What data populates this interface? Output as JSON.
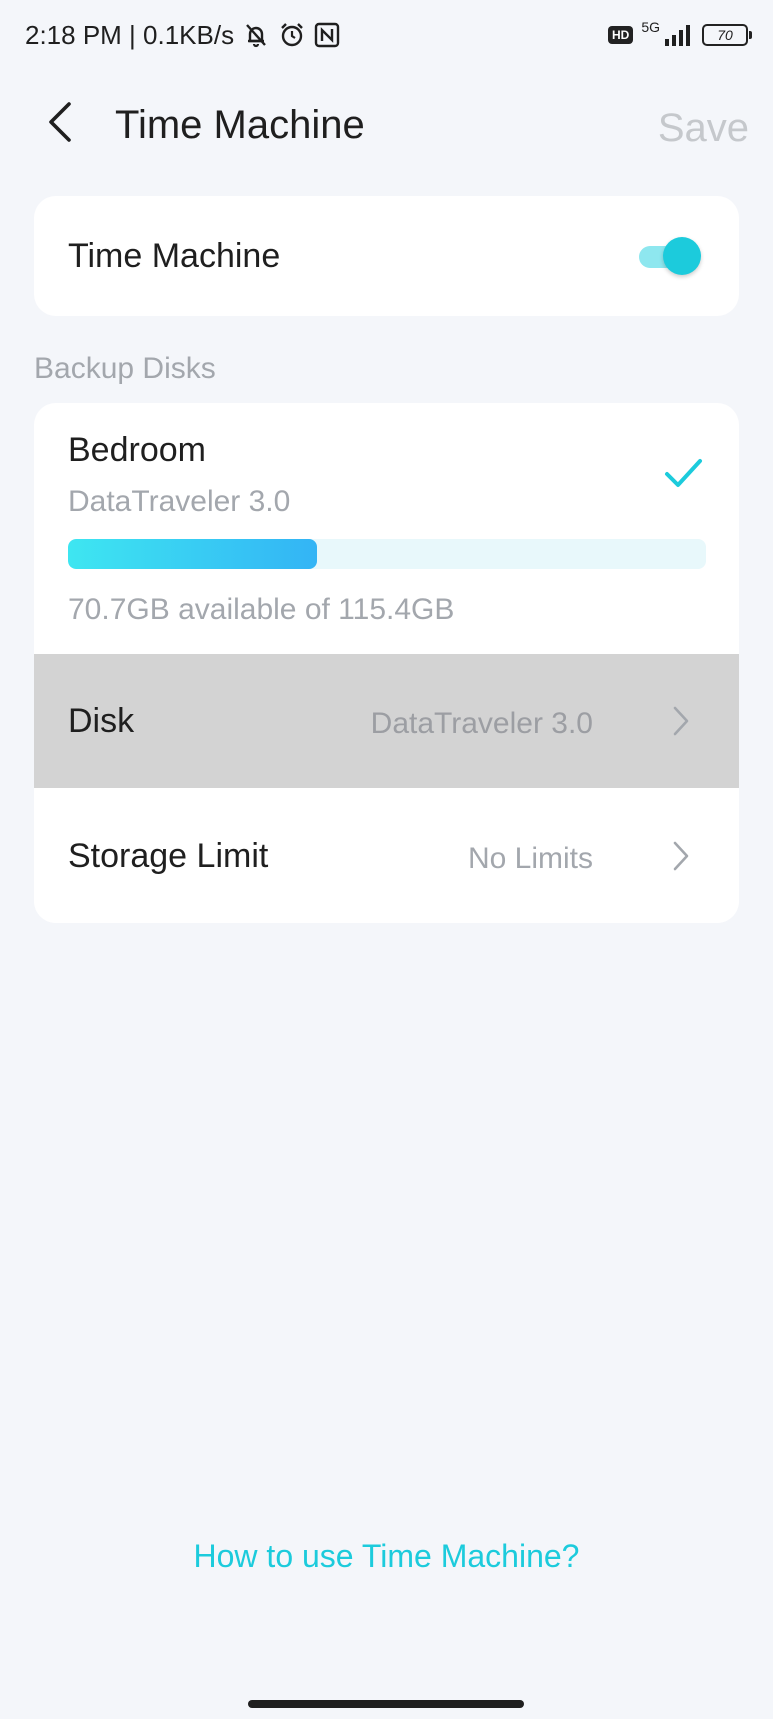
{
  "status_bar": {
    "time_speed": "2:18 PM | 0.1KB/s",
    "hd": "HD",
    "network": "5G",
    "battery": "70",
    "icons": [
      "bell-muted-icon",
      "alarm-icon",
      "nfc-icon",
      "signal-icon",
      "battery-icon"
    ]
  },
  "header": {
    "title": "Time Machine",
    "save_label": "Save"
  },
  "toggle": {
    "label": "Time Machine",
    "enabled": true
  },
  "backup_disks": {
    "section_label": "Backup Disks",
    "disk": {
      "name": "Bedroom",
      "model": "DataTraveler 3.0",
      "usage_fraction": 0.39,
      "usage_text": "70.7GB available of 115.4GB",
      "selected": true
    },
    "rows": [
      {
        "label": "Disk",
        "value": "DataTraveler 3.0"
      },
      {
        "label": "Storage Limit",
        "value": "No Limits"
      }
    ]
  },
  "help": {
    "link_text": "How to use Time Machine?"
  },
  "colors": {
    "accent": "#1ccbdc",
    "background": "#f4f6fa",
    "muted_text": "#a3a7ad",
    "pressed_row": "#d3d3d3"
  }
}
